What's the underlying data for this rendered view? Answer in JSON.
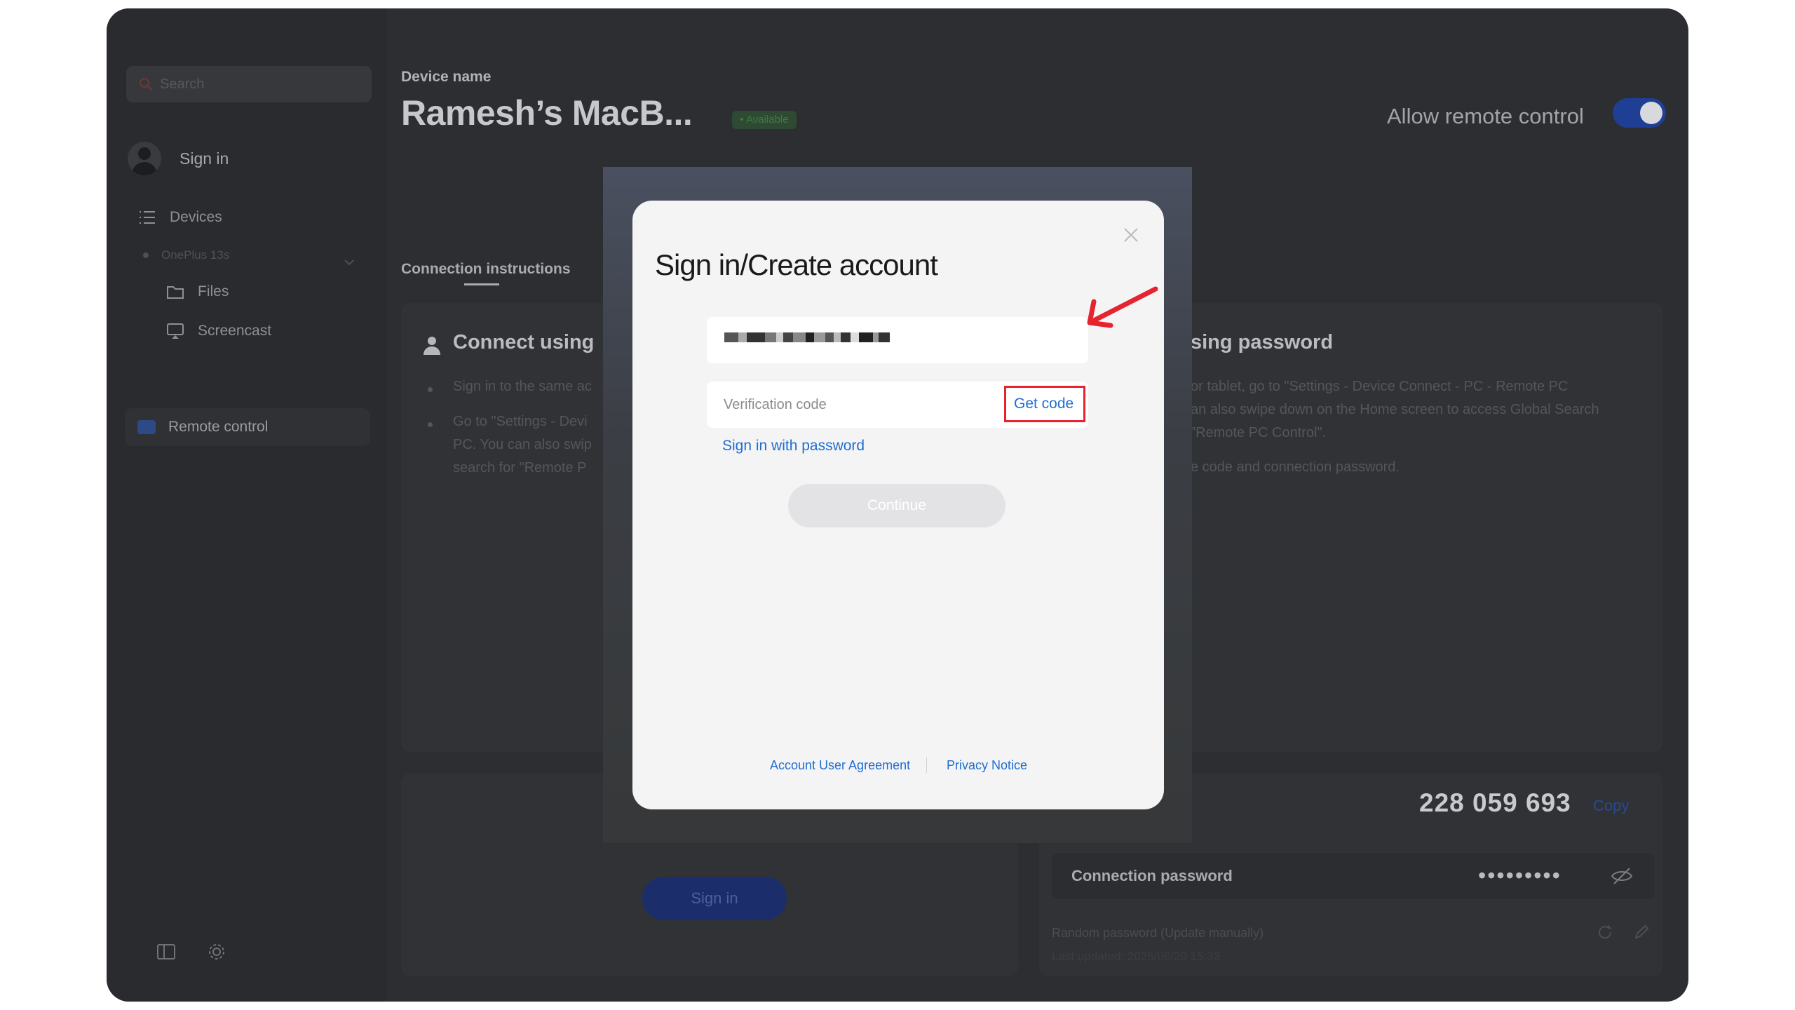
{
  "sidebar": {
    "search_placeholder": "Search",
    "signin_label": "Sign in",
    "devices_label": "Devices",
    "device_name": "OnePlus 13s",
    "files_label": "Files",
    "screencast_label": "Screencast",
    "remote_label": "Remote control"
  },
  "header": {
    "device_name_label": "Device name",
    "device_title": "Ramesh’s MacB...",
    "status_badge": "• Available",
    "allow_remote_label": "Allow remote control",
    "allow_remote_on": true
  },
  "tabs": {
    "connection_instructions": "Connection instructions"
  },
  "cards": {
    "left_title": "Connect using",
    "left_bullet1": "Sign in to the same ac",
    "left_bullet2_line1": "Go to \"Settings - Devi",
    "left_bullet2_line2": "PC. You can also swip",
    "left_bullet2_line3": "search for \"Remote P",
    "right_title": "sing password",
    "right_text_line1": "or tablet, go to \"Settings - Device Connect - PC - Remote PC",
    "right_text_line2": "an also swipe down on the Home screen to access Global Search",
    "right_text_line3": "\"Remote PC Control\".",
    "right_text_line4": "e code and connection password.",
    "signin_button": "Sign in",
    "connection_code": "228 059 693",
    "copy_label": "Copy",
    "connection_password_label": "Connection password",
    "password_dots": "•••••••••",
    "random_password_label": "Random password (Update manually)",
    "random_password_sub": "Last updated: 2025/06/20 15:32"
  },
  "modal": {
    "title": "Sign in/Create account",
    "verification_placeholder": "Verification code",
    "get_code": "Get code",
    "sign_in_with_password": "Sign in with password",
    "continue": "Continue",
    "account_user_agreement": "Account User Agreement",
    "privacy_notice": "Privacy Notice"
  },
  "colors": {
    "accent_blue": "#1f6ed1",
    "highlight_red": "#e5242f",
    "toggle_blue": "#1f3f95"
  }
}
